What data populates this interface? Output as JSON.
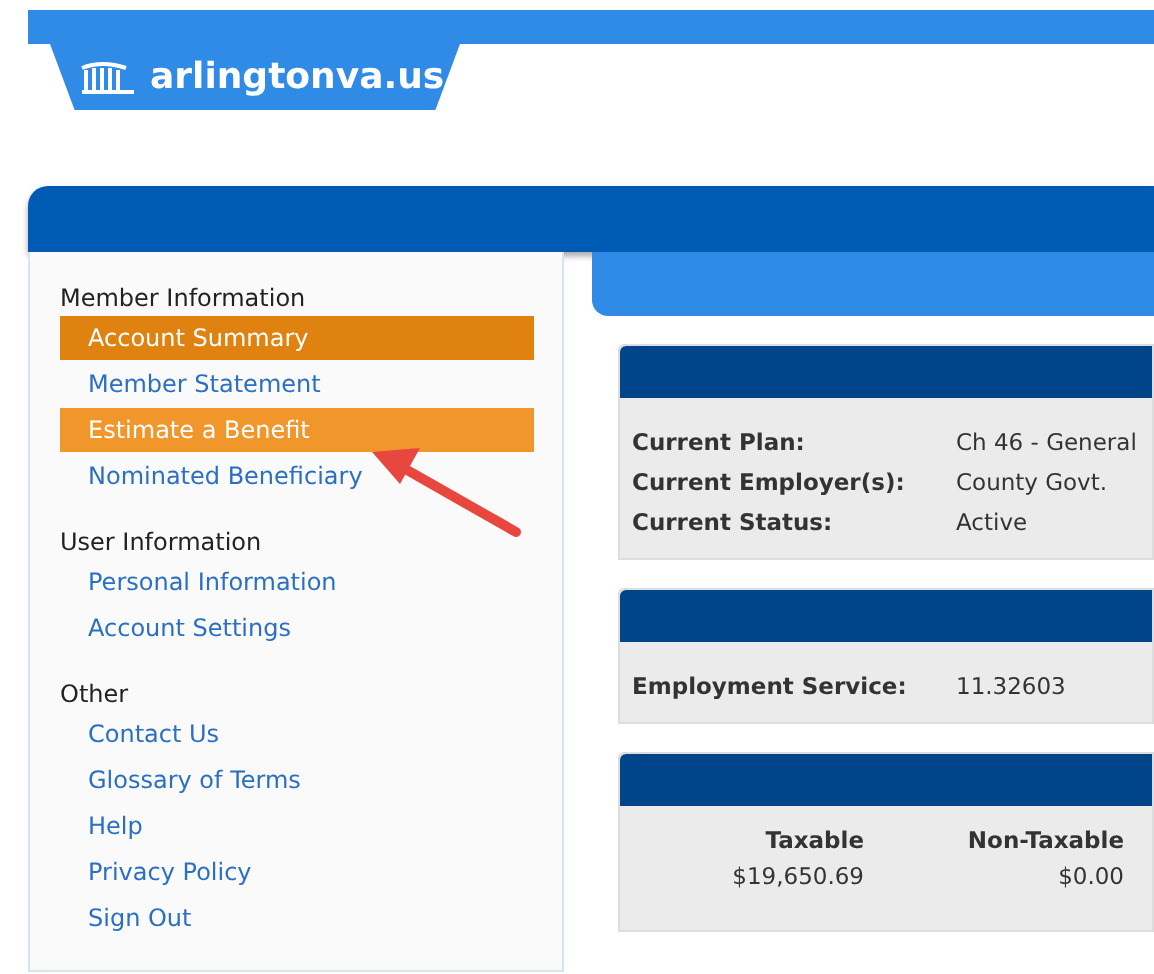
{
  "header": {
    "logo_text": "arlingtonva.us"
  },
  "sidebar": {
    "sections": [
      {
        "heading": "Member Information",
        "items": [
          {
            "label": "Account Summary",
            "selected": true,
            "hovered": false
          },
          {
            "label": "Member Statement",
            "selected": false,
            "hovered": false
          },
          {
            "label": "Estimate a Benefit",
            "selected": false,
            "hovered": true
          },
          {
            "label": "Nominated Beneficiary",
            "selected": false,
            "hovered": false
          }
        ]
      },
      {
        "heading": "User Information",
        "items": [
          {
            "label": "Personal Information",
            "selected": false,
            "hovered": false
          },
          {
            "label": "Account Settings",
            "selected": false,
            "hovered": false
          }
        ]
      },
      {
        "heading": "Other",
        "items": [
          {
            "label": "Contact Us",
            "selected": false,
            "hovered": false
          },
          {
            "label": "Glossary of Terms",
            "selected": false,
            "hovered": false
          },
          {
            "label": "Help",
            "selected": false,
            "hovered": false
          },
          {
            "label": "Privacy Policy",
            "selected": false,
            "hovered": false
          },
          {
            "label": "Sign Out",
            "selected": false,
            "hovered": false
          }
        ]
      }
    ]
  },
  "panels": [
    {
      "kind": "pairs",
      "rows": [
        {
          "label": "Current Plan:",
          "value": "Ch 46 - General"
        },
        {
          "label": "Current Employer(s):",
          "value": "County Govt."
        },
        {
          "label": "Current Status:",
          "value": "Active"
        }
      ]
    },
    {
      "kind": "pairs",
      "rows": [
        {
          "label": "Employment Service:",
          "value": "11.32603"
        }
      ]
    },
    {
      "kind": "columns",
      "columns": [
        {
          "heading": "Taxable",
          "value": "$19,650.69"
        },
        {
          "heading": "Non-Taxable",
          "value": "$0.00"
        }
      ]
    }
  ]
}
